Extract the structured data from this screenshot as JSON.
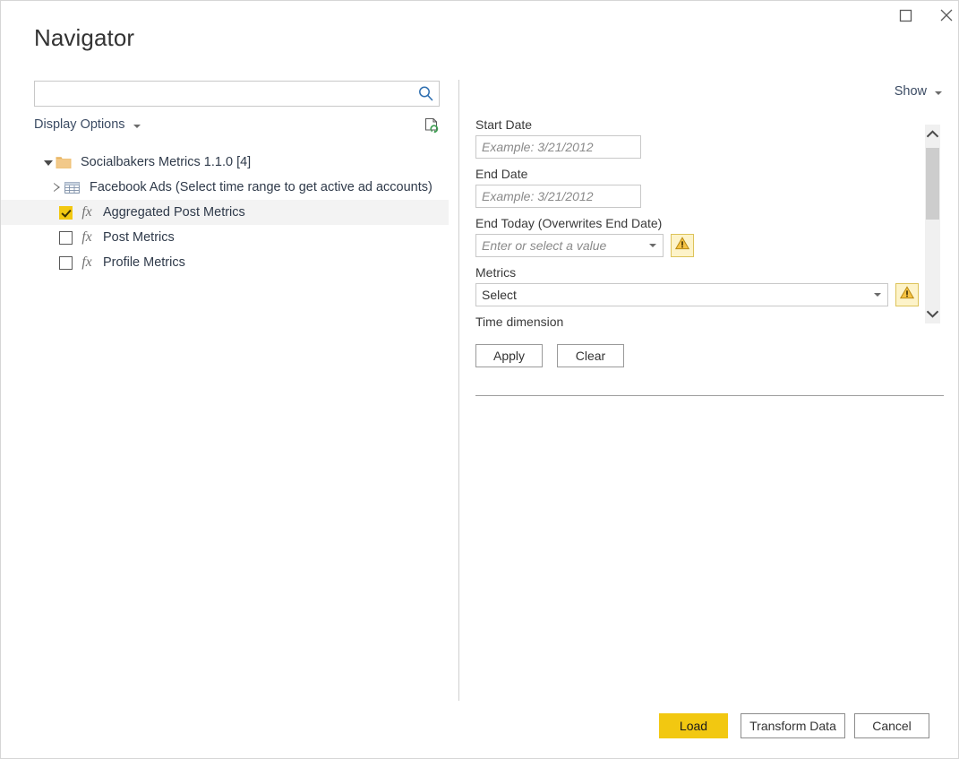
{
  "window": {
    "title": "Navigator",
    "controls": [
      {
        "name": "maximize-button",
        "icon": "maximize-icon"
      },
      {
        "name": "close-button",
        "icon": "close-icon"
      }
    ]
  },
  "left_pane": {
    "search": {
      "value": "",
      "placeholder": "",
      "icon": "search-icon"
    },
    "display_options_label": "Display Options",
    "refresh_icon": "refresh-page-icon",
    "tree": [
      {
        "label": "Socialbakers Metrics 1.1.0 [4]",
        "icon": "folder-icon",
        "twisty": "expanded",
        "level": 0,
        "checkbox": "none",
        "selected": false
      },
      {
        "label": "Facebook Ads (Select time range to get active ad accounts)",
        "icon": "table-icon",
        "twisty": "collapsed",
        "level": 1,
        "checkbox": "none",
        "selected": false
      },
      {
        "label": "Aggregated Post Metrics",
        "icon": "function-icon",
        "twisty": "none",
        "level": 2,
        "checkbox": "checked",
        "selected": true
      },
      {
        "label": "Post Metrics",
        "icon": "function-icon",
        "twisty": "none",
        "level": 2,
        "checkbox": "unchecked",
        "selected": false
      },
      {
        "label": "Profile Metrics",
        "icon": "function-icon",
        "twisty": "none",
        "level": 2,
        "checkbox": "unchecked",
        "selected": false
      }
    ]
  },
  "right_pane": {
    "show_label": "Show",
    "fields": {
      "start_date": {
        "label": "Start Date",
        "value": "",
        "placeholder": "Example: 3/21/2012"
      },
      "end_date": {
        "label": "End Date",
        "value": "",
        "placeholder": "Example: 3/21/2012"
      },
      "end_today": {
        "label": "End Today (Overwrites End Date)",
        "value": "",
        "placeholder": "Enter or select a value",
        "warning_icon": "warning-triangle-icon"
      },
      "metrics": {
        "label": "Metrics",
        "value": "Select",
        "warning_icon": "warning-triangle-icon"
      },
      "time_dimension": {
        "label": "Time dimension"
      }
    },
    "buttons": {
      "apply": "Apply",
      "clear": "Clear"
    },
    "scrollbar": {
      "up_icon": "chevron-up-icon",
      "down_icon": "chevron-down-icon"
    }
  },
  "footer": {
    "load": "Load",
    "transform": "Transform Data",
    "cancel": "Cancel"
  },
  "colors": {
    "accent_yellow": "#f2c811",
    "warning_bg": "#fdf3c9",
    "warning_border": "#ddc35a",
    "selection_bg": "#f3f3f3",
    "link_text": "#3b4b63"
  }
}
